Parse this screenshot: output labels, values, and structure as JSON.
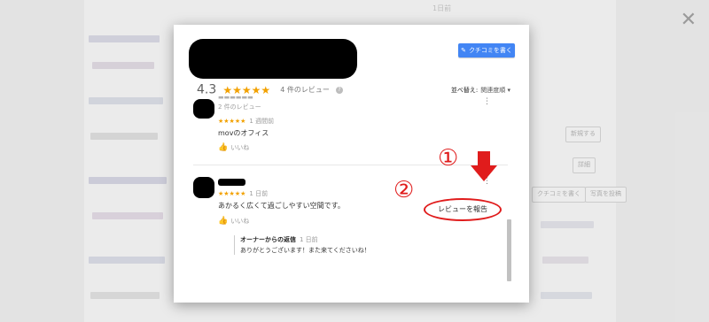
{
  "background": {
    "text_top": "1日前",
    "chips": [
      "新規する",
      "詳細",
      "クチコミを書く",
      "写真を投稿"
    ]
  },
  "dialog": {
    "write_review_label": "クチコミを書く",
    "rating": "4.3",
    "stars": "★★★★★",
    "review_count": "4 件のレビュー",
    "help_icon": "?",
    "sort_label": "並べ替え:",
    "sort_value": "関連度順 ▾",
    "close_icon": "✕"
  },
  "reviews": [
    {
      "meta": "2 件のレビュー",
      "stars": "★★★★★",
      "date": "1 週間前",
      "text": "movのオフィス",
      "like_label": "いいね"
    },
    {
      "stars": "★★★★★",
      "date": "1 日前",
      "text": "あかるく広くて過ごしやすい空間です。",
      "like_label": "いいね",
      "owner_reply": {
        "label": "オーナーからの返信",
        "date": "1 日前",
        "text": "ありがとうございます！また来てくださいね！"
      }
    }
  ],
  "annotations": {
    "step1": "①",
    "step2": "②",
    "report_label": "レビューを報告",
    "arrow_color": "#e01c1c"
  }
}
